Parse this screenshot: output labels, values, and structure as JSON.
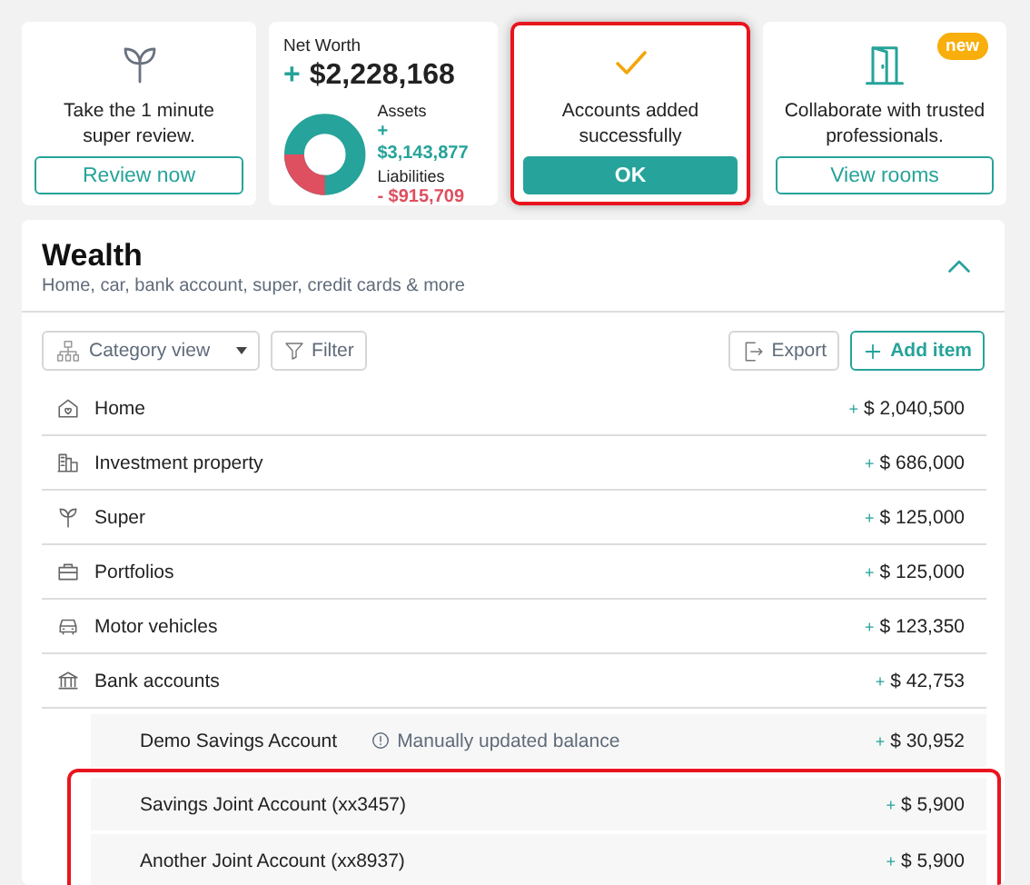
{
  "cards": [
    {
      "kind": "super_review",
      "text": "Take the 1 minute super review.",
      "button": "Review now",
      "highlighted": false
    },
    {
      "kind": "net_worth",
      "title": "Net Worth",
      "sign": "+",
      "total": "$2,228,168",
      "assets_label": "Assets",
      "assets": "+ $3,143,877",
      "liabilities_label": "Liabilities",
      "liabilities": "- $915,709"
    },
    {
      "kind": "confirmation",
      "text": "Accounts added successfully",
      "button": "OK",
      "highlighted": true
    },
    {
      "kind": "rooms",
      "badge": "new",
      "text": "Collaborate with trusted professionals.",
      "button": "View rooms",
      "highlighted": false
    }
  ],
  "wealth": {
    "title": "Wealth",
    "subtitle": "Home, car, bank account, super, credit cards & more",
    "expanded": true,
    "toolbar": {
      "view": "Category view",
      "filter": "Filter",
      "export": "Export",
      "add": "Add item"
    },
    "rows": [
      {
        "kind": "home",
        "label": "Home",
        "sign": "+",
        "amount": "$ 2,040,500"
      },
      {
        "kind": "investment_property",
        "label": "Investment property",
        "sign": "+",
        "amount": "$ 686,000"
      },
      {
        "kind": "super",
        "label": "Super",
        "sign": "+",
        "amount": "$ 125,000"
      },
      {
        "kind": "portfolios",
        "label": "Portfolios",
        "sign": "+",
        "amount": "$ 125,000"
      },
      {
        "kind": "motor_vehicles",
        "label": "Motor vehicles",
        "sign": "+",
        "amount": "$ 123,350"
      },
      {
        "kind": "bank_accounts",
        "label": "Bank accounts",
        "sign": "+",
        "amount": "$ 42,753",
        "children": [
          {
            "label": "Demo Savings Account",
            "note": "Manually updated balance",
            "sign": "+",
            "amount": "$ 30,952",
            "highlighted": false
          },
          {
            "label": "Savings Joint Account (xx3457)",
            "sign": "+",
            "amount": "$ 5,900",
            "highlighted": true
          },
          {
            "label": "Another Joint Account (xx8937)",
            "sign": "+",
            "amount": "$ 5,900",
            "highlighted": true
          }
        ]
      }
    ]
  }
}
